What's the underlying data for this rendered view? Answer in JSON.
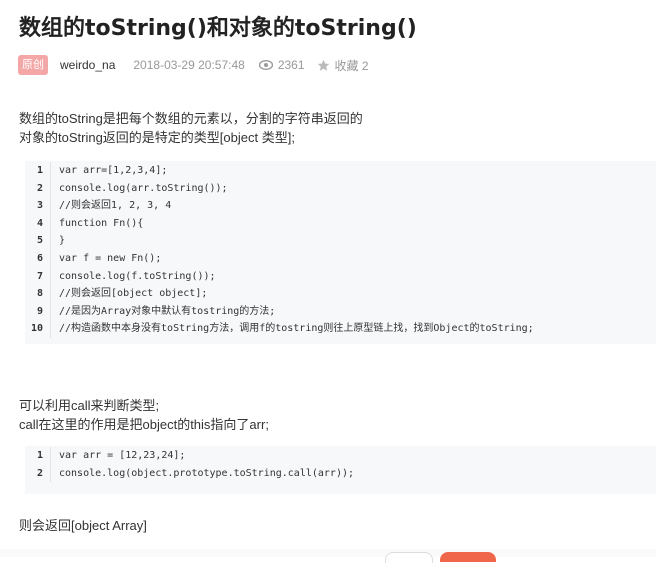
{
  "article": {
    "title": "数组的toString()和对象的toString()",
    "badge": "原创",
    "author": "weirdo_na",
    "date": "2018-03-29 20:57:48",
    "views": "2361",
    "favorites": "收藏 2"
  },
  "paragraphs": {
    "p1_line1": "数组的toString是把每个数组的元素以，分割的字符串返回的",
    "p1_line2": "对象的toString返回的是特定的类型[object  类型];",
    "p2_line1": "可以利用call来判断类型;",
    "p2_line2": "call在这里的作用是把object的this指向了arr;",
    "p3": "则会返回[object Array]"
  },
  "code_block_1": [
    {
      "n": "1",
      "code": "var arr=[1,2,3,4];"
    },
    {
      "n": "2",
      "code": "console.log(arr.toString());"
    },
    {
      "n": "3",
      "code": "//则会返回1, 2, 3, 4"
    },
    {
      "n": "4",
      "code": "function Fn(){"
    },
    {
      "n": "5",
      "code": "}"
    },
    {
      "n": "6",
      "code": "var f = new Fn();"
    },
    {
      "n": "7",
      "code": "console.log(f.toString());"
    },
    {
      "n": "8",
      "code": "//则会返回[object object];"
    },
    {
      "n": "9",
      "code": "//是因为Array对象中默认有tostring的方法;"
    },
    {
      "n": "10",
      "code": "//构造函数中本身没有toString方法，调用f的tostring则往上原型链上找，找到Object的toString;"
    }
  ],
  "code_block_2": [
    {
      "n": "1",
      "code": "var arr = [12,23,24];"
    },
    {
      "n": "2",
      "code": "console.log(object.prototype.toString.call(arr));"
    }
  ],
  "colors": {
    "badge_bg": "#f4a7a7",
    "code_bg": "#f6f8fa",
    "accent_red": "#f0664a"
  }
}
